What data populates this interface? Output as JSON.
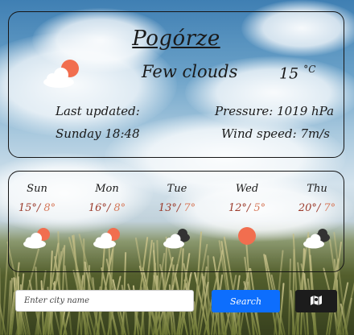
{
  "current": {
    "city": "Pogórze",
    "description": "Few clouds",
    "temperature": "15",
    "unit": "°C",
    "icon": "few-clouds-day-icon",
    "last_updated_label": "Last updated:",
    "last_updated_value": "Sunday 18:48",
    "pressure": "Pressure: 1019 hPa",
    "wind": "Wind speed: 7m/s"
  },
  "forecast": [
    {
      "day": "Sun",
      "high": "15°",
      "low": "8°",
      "icon": "few-clouds-day-icon"
    },
    {
      "day": "Mon",
      "high": "16°",
      "low": "8°",
      "icon": "few-clouds-day-icon"
    },
    {
      "day": "Tue",
      "high": "13°",
      "low": "7°",
      "icon": "broken-clouds-icon"
    },
    {
      "day": "Wed",
      "high": "12°",
      "low": "5°",
      "icon": "clear-sky-icon"
    },
    {
      "day": "Thu",
      "high": "20°",
      "low": "7°",
      "icon": "broken-clouds-icon"
    }
  ],
  "search": {
    "placeholder": "Enter city name",
    "button_label": "Search",
    "map_button_icon": "map-icon"
  },
  "colors": {
    "sun": "#f16e4f",
    "dark_cloud": "#333333",
    "search_button": "#0d6efd",
    "map_button": "#1c1c1c",
    "forecast_high": "#9c3b2c",
    "forecast_low": "#d77a5c"
  }
}
